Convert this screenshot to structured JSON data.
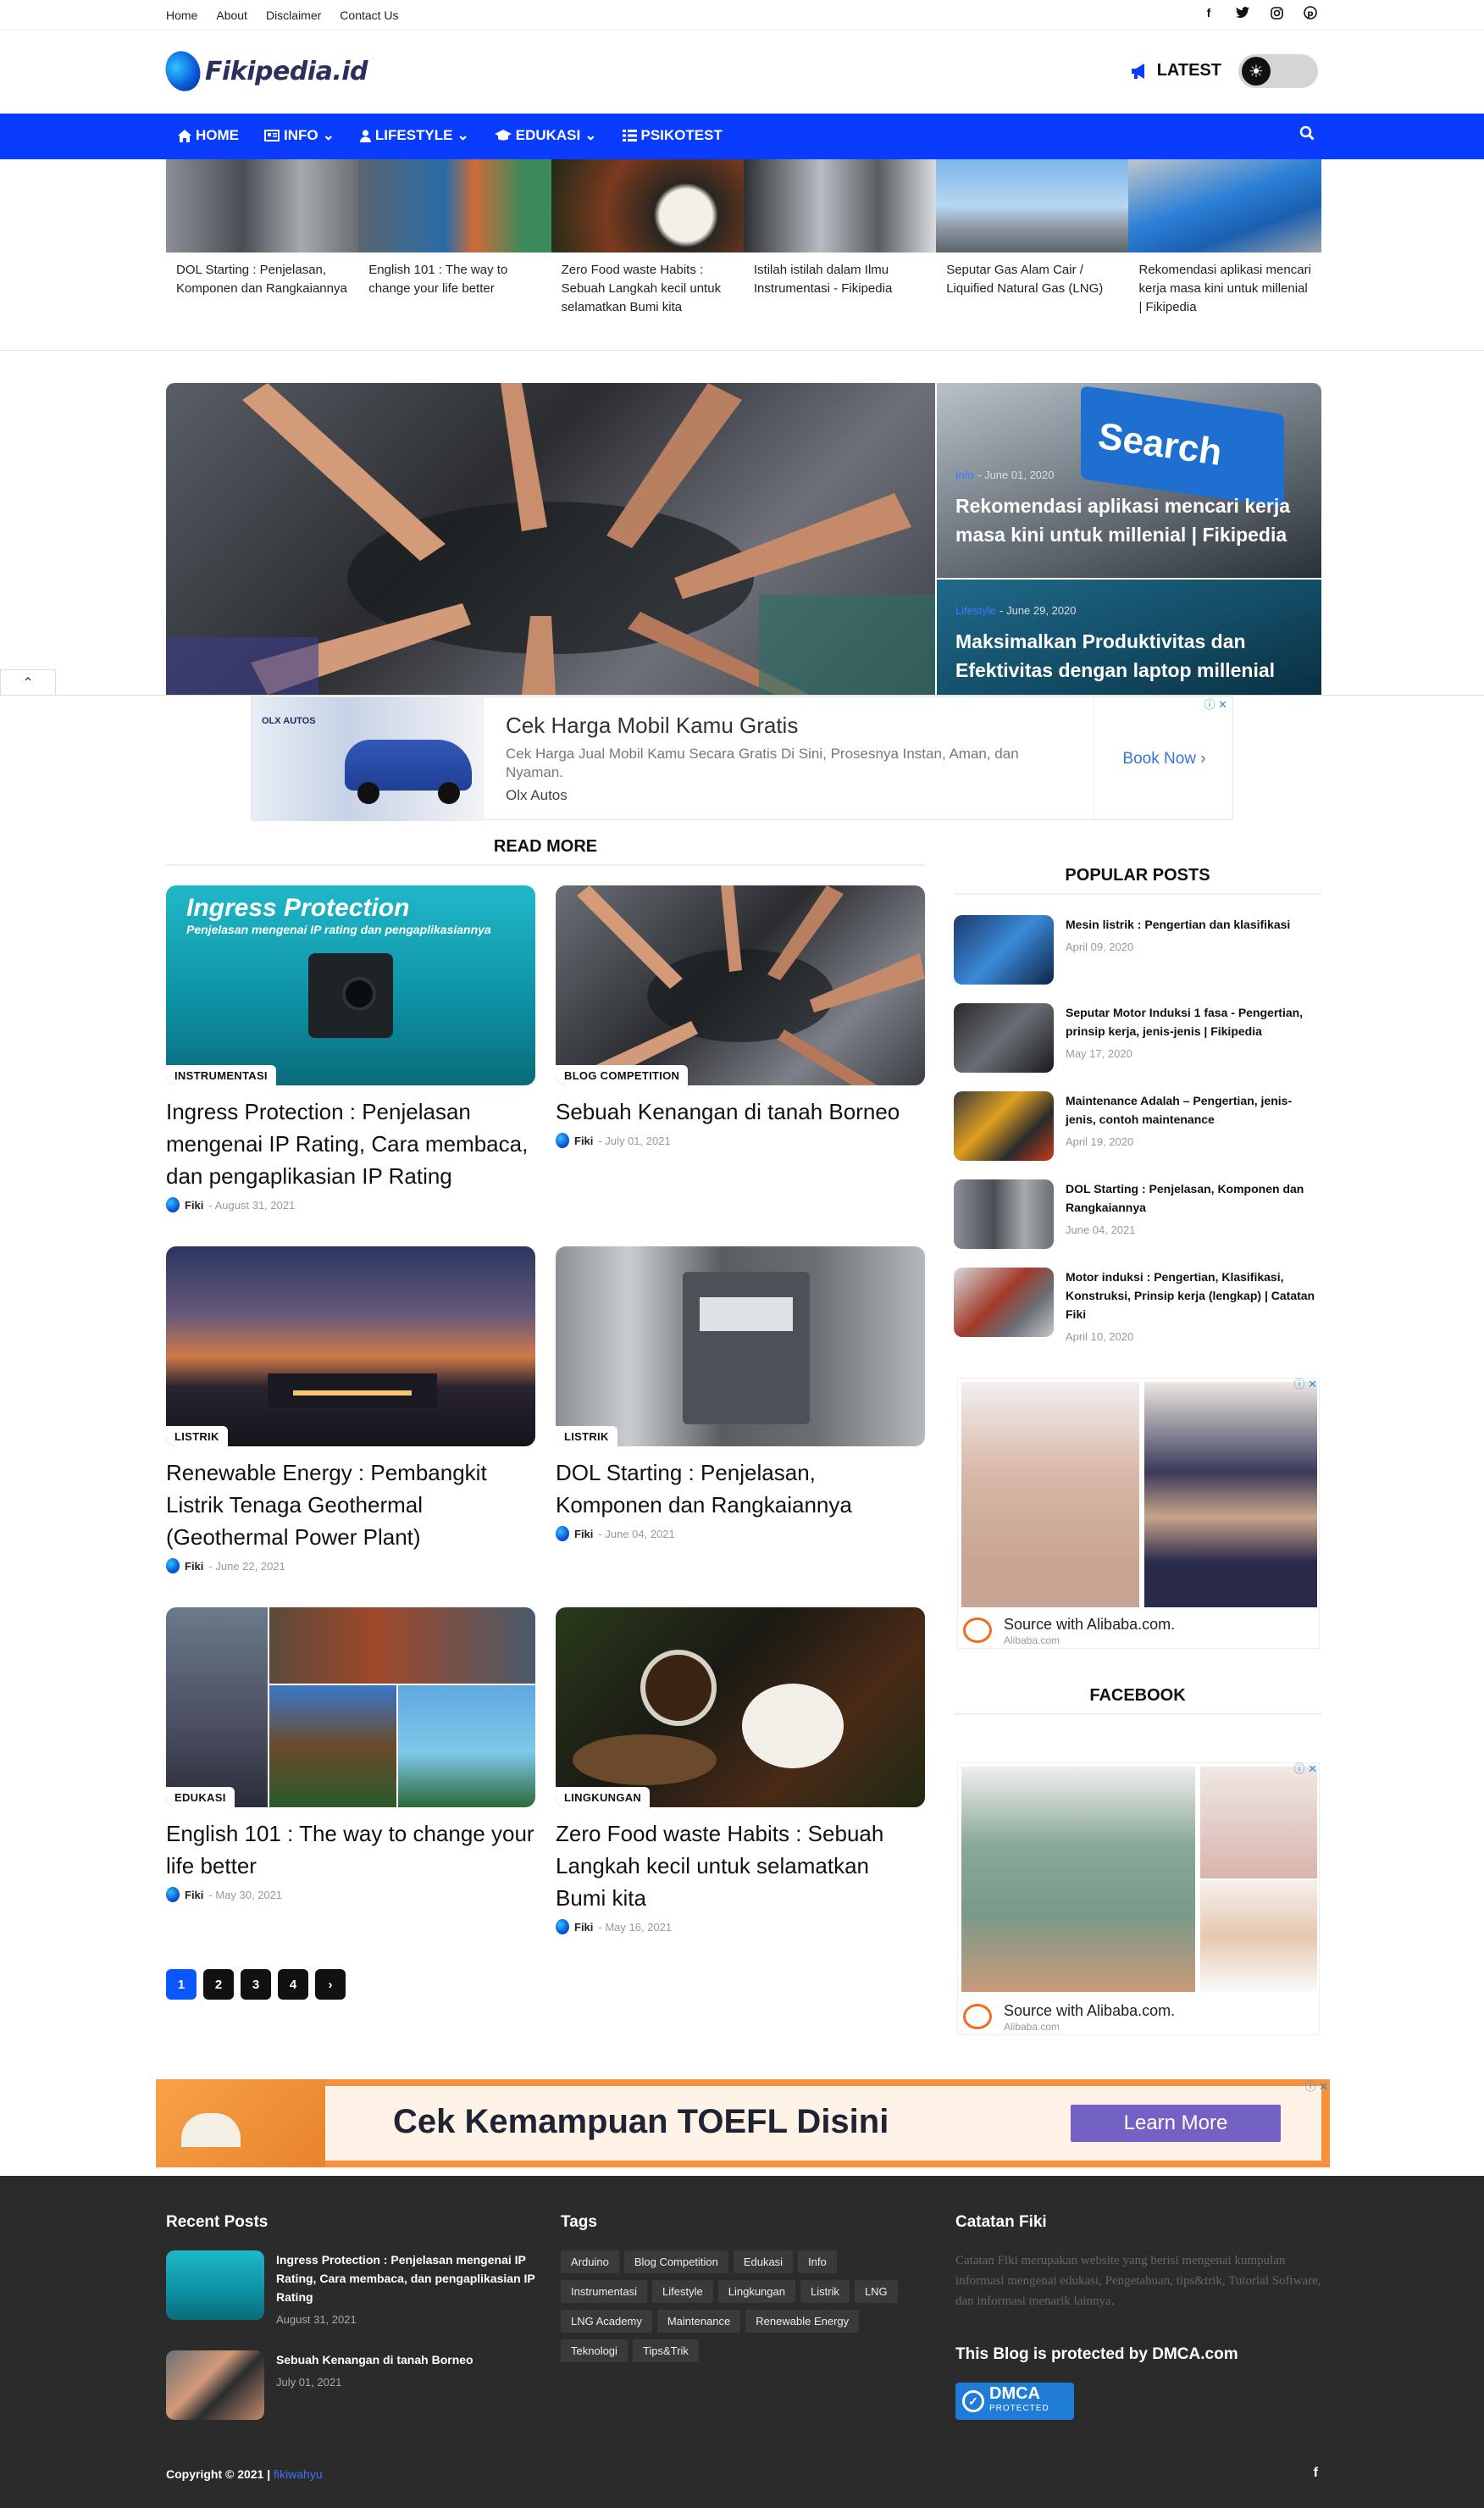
{
  "topnav": [
    "Home",
    "About",
    "Disclaimer",
    "Contact Us"
  ],
  "social_icons": [
    "facebook-icon",
    "twitter-icon",
    "instagram-icon",
    "pinterest-icon"
  ],
  "brand": {
    "name": "Fikipedia.id"
  },
  "header": {
    "latest_label": "LATEST"
  },
  "nav": {
    "items": [
      {
        "label": "HOME",
        "icon": "home-icon",
        "dropdown": false
      },
      {
        "label": "INFO",
        "icon": "newspaper-icon",
        "dropdown": true
      },
      {
        "label": "LIFESTYLE",
        "icon": "user-icon",
        "dropdown": true
      },
      {
        "label": "EDUKASI",
        "icon": "graduation-cap-icon",
        "dropdown": true
      },
      {
        "label": "PSIKOTEST",
        "icon": "list-icon",
        "dropdown": false
      }
    ]
  },
  "ticker": [
    "DOL Starting : Penjelasan, Komponen dan Rangkaiannya",
    "English 101 : The way to change your life better",
    "Zero Food waste Habits : Sebuah Langkah kecil untuk selamatkan Bumi kita",
    "Istilah istilah dalam Ilmu Instrumentasi - Fikipedia",
    "Seputar Gas Alam Cair / Liquified Natural Gas (LNG)",
    "Rekomendasi aplikasi mencari kerja masa kini untuk millenial | Fikipedia"
  ],
  "hero": {
    "side": [
      {
        "category": "Info",
        "date": "June 01, 2020",
        "title": "Rekomendasi aplikasi mencari kerja masa kini untuk millenial | Fikipedia"
      },
      {
        "category": "Lifestyle",
        "date": "June 29, 2020",
        "title": "Maksimalkan Produktivitas dan Efektivitas dengan laptop millenial"
      }
    ]
  },
  "ad1": {
    "title": "Cek Harga Mobil Kamu Gratis",
    "description": "Cek Harga Jual Mobil Kamu Secara Gratis Di Sini, Prosesnya Instan, Aman, dan Nyaman.",
    "source": "Olx Autos",
    "cta": "Book Now",
    "image_text": "OLX AUTOS"
  },
  "readmore": {
    "heading": "READ MORE",
    "author": "Fiki",
    "posts": [
      {
        "category": "INSTRUMENTASI",
        "title": "Ingress Protection : Penjelasan mengenai IP Rating, Cara membaca, dan pengaplikasian IP Rating",
        "date": "August 31, 2021",
        "overlay_title": "Ingress Protection",
        "overlay_sub": "Penjelasan mengenai IP rating dan pengaplikasiannya"
      },
      {
        "category": "BLOG COMPETITION",
        "title": "Sebuah Kenangan di tanah Borneo",
        "date": "July 01, 2021"
      },
      {
        "category": "LISTRIK",
        "title": "Renewable Energy : Pembangkit Listrik Tenaga Geothermal (Geothermal Power Plant)",
        "date": "June 22, 2021"
      },
      {
        "category": "LISTRIK",
        "title": "DOL Starting : Penjelasan, Komponen dan Rangkaiannya",
        "date": "June 04, 2021"
      },
      {
        "category": "EDUKASI",
        "title": "English 101 : The way to change your life better",
        "date": "May 30, 2021"
      },
      {
        "category": "LINGKUNGAN",
        "title": "Zero Food waste Habits : Sebuah Langkah kecil untuk selamatkan Bumi kita",
        "date": "May 16, 2021"
      }
    ]
  },
  "pagination": [
    "1",
    "2",
    "3",
    "4"
  ],
  "popular": {
    "heading": "POPULAR POSTS",
    "items": [
      {
        "title": "Mesin listrik : Pengertian dan klasifikasi",
        "date": "April 09, 2020"
      },
      {
        "title": "Seputar Motor Induksi 1 fasa - Pengertian, prinsip kerja, jenis-jenis | Fikipedia",
        "date": "May 17, 2020"
      },
      {
        "title": "Maintenance Adalah – Pengertian, jenis-jenis, contoh maintenance",
        "date": "April 19, 2020"
      },
      {
        "title": "DOL Starting : Penjelasan, Komponen dan Rangkaiannya",
        "date": "June 04, 2021"
      },
      {
        "title": "Motor induksi : Pengertian, Klasifikasi, Konstruksi, Prinsip kerja (lengkap) | Catatan Fiki",
        "date": "April 10, 2020"
      }
    ]
  },
  "ali_ad": {
    "source": "Source with Alibaba.com.",
    "domain": "Alibaba.com"
  },
  "facebook_heading": "FACEBOOK",
  "ad2": {
    "title": "Cek Kemampuan TOEFL Disini",
    "cta": "Learn More"
  },
  "footer": {
    "recent_heading": "Recent Posts",
    "recent": [
      {
        "title": "Ingress Protection : Penjelasan mengenai IP Rating, Cara membaca, dan pengaplikasian IP Rating",
        "date": "August 31, 2021"
      },
      {
        "title": "Sebuah Kenangan di tanah Borneo",
        "date": "July 01, 2021"
      }
    ],
    "tags_heading": "Tags",
    "tags": [
      "Arduino",
      "Blog Competition",
      "Edukasi",
      "Info",
      "Instrumentasi",
      "Lifestyle",
      "Lingkungan",
      "Listrik",
      "LNG",
      "LNG Academy",
      "Maintenance",
      "Renewable Energy",
      "Teknologi",
      "Tips&Trik"
    ],
    "about_heading": "Catatan Fiki",
    "about_text": "Catatan Fiki merupakan website yang berisi mengenai kumpulan informasi mengenai edukasi, Pengetahuan, tips&trik, Tutorial Software, dan informasi menarik lainnya.",
    "dmca_heading": "This Blog is protected by DMCA.com",
    "dmca_badge": "DMCA",
    "dmca_sub": "PROTECTED",
    "copyright": "Copyright © 2021 |",
    "copyright_link": "fikiwahyu"
  }
}
